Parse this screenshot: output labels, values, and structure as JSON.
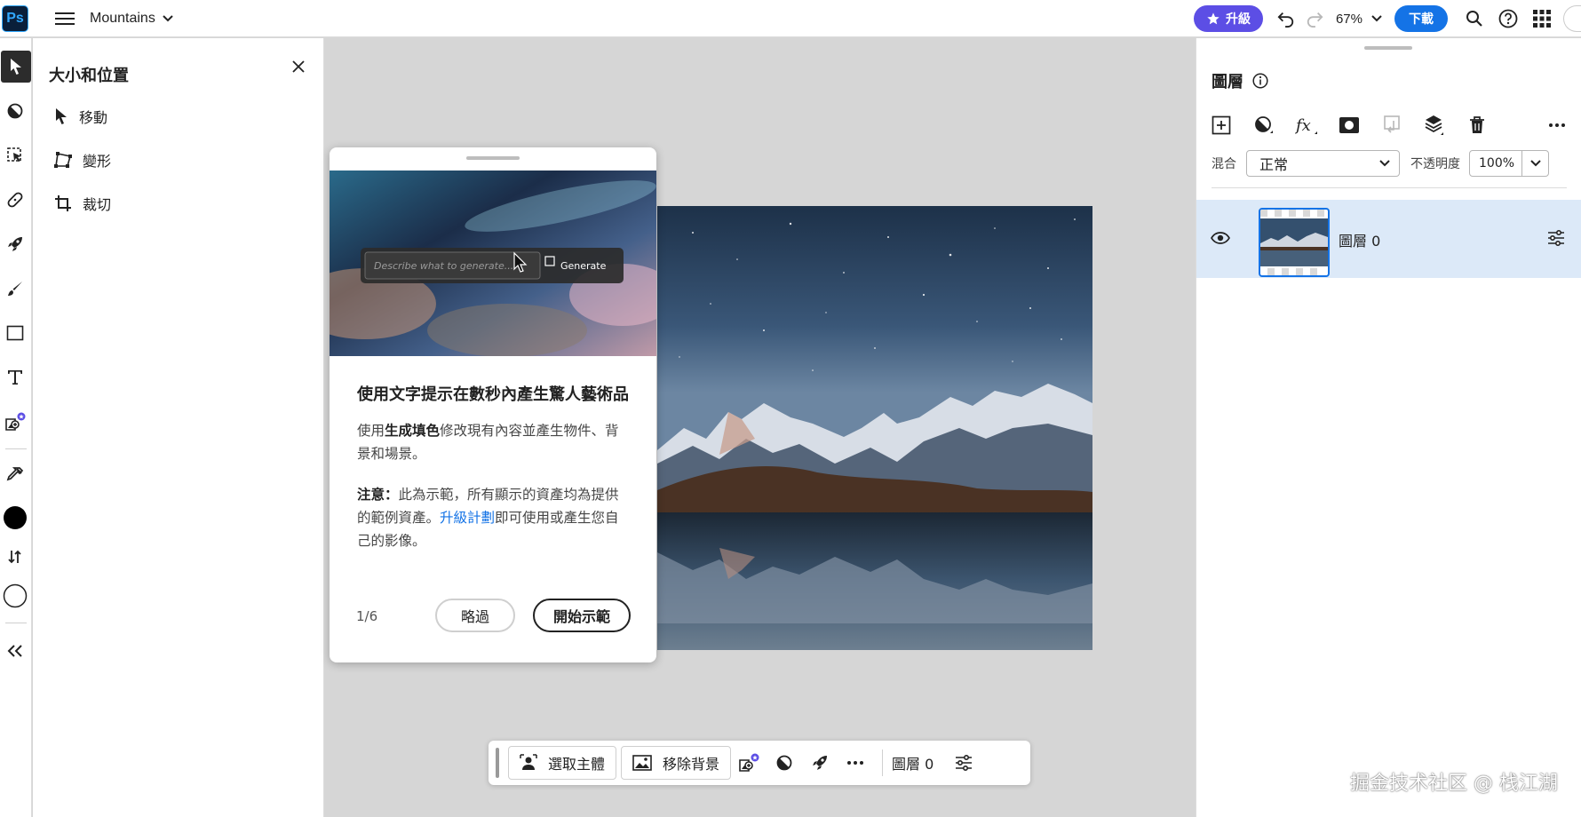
{
  "app": {
    "logo_text": "Ps",
    "document_title": "Mountains"
  },
  "header": {
    "upgrade_label": "升級",
    "zoom": "67%",
    "download_label": "下載"
  },
  "properties_panel": {
    "title": "大小和位置",
    "items": [
      {
        "label": "移動",
        "icon": "move-arrow-icon"
      },
      {
        "label": "變形",
        "icon": "transform-icon"
      },
      {
        "label": "裁切",
        "icon": "crop-icon"
      }
    ]
  },
  "onboarding": {
    "hero_placeholder": "Describe what to generate...",
    "hero_button": "Generate",
    "heading": "使用文字提示在數秒內產生驚人藝術品",
    "body_pre": "使用",
    "body_bold": "生成填色",
    "body_post": "修改現有內容並產生物件、背景和場景。",
    "note_bold": "注意：",
    "note_pre": "此為示範，所有顯示的資產均為提供的範例資產。",
    "note_link": "升級計劃",
    "note_post": "即可使用或產生您自己的影像。",
    "step": "1/6",
    "skip_label": "略過",
    "start_label": "開始示範"
  },
  "taskbar": {
    "select_subject": "選取主體",
    "remove_background": "移除背景",
    "layer_label": "圖層 0"
  },
  "layers_panel": {
    "title": "圖層",
    "blend_label": "混合",
    "blend_mode": "正常",
    "opacity_label": "不透明度",
    "opacity_value": "100%",
    "layers": [
      {
        "name": "圖層 0",
        "visible": true,
        "selected": true
      }
    ]
  },
  "watermark": "掘金技术社区 @ 栈江湖",
  "colors": {
    "accent_blue": "#1473e6",
    "upgrade_purple": "#5c4ee5",
    "selected_layer_bg": "#dce9f8",
    "canvas_bg": "#d6d6d6"
  }
}
